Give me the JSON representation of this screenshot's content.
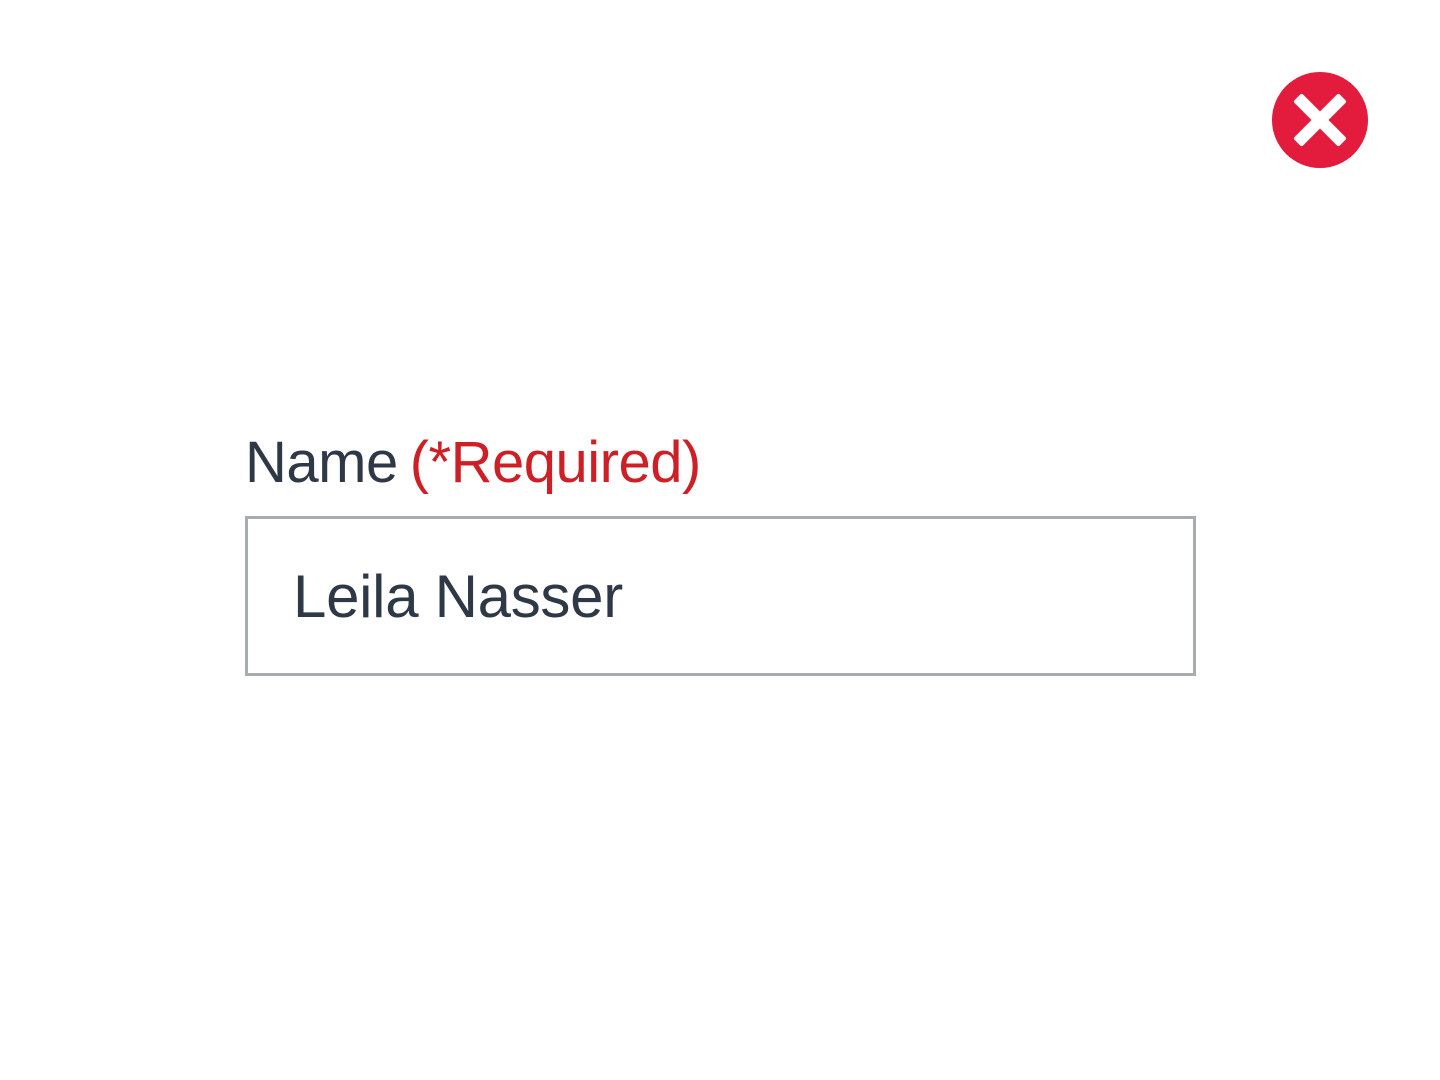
{
  "close_button": {
    "icon": "close-icon",
    "color": "#e31c3d"
  },
  "name_field": {
    "label": "Name",
    "required_label": "(*Required)",
    "value": "Leila Nasser",
    "label_color": "#2e3846",
    "required_color": "#cd2026",
    "border_color": "#a7acaf"
  }
}
